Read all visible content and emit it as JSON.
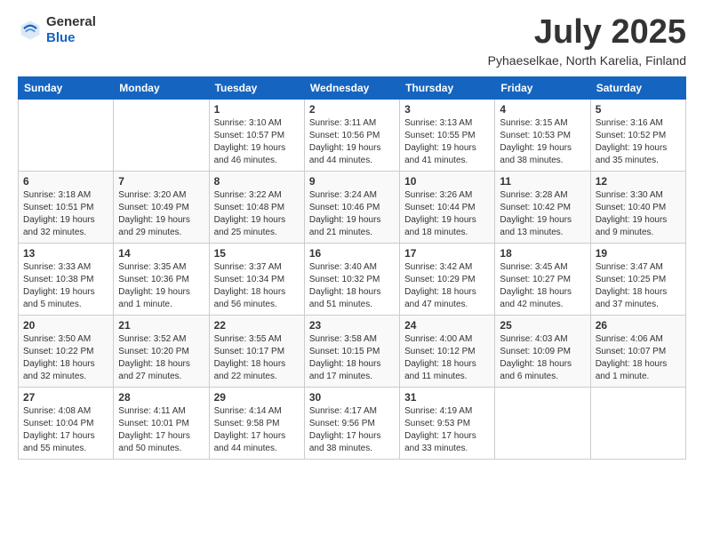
{
  "logo": {
    "general": "General",
    "blue": "Blue"
  },
  "header": {
    "month": "July 2025",
    "location": "Pyhaeselkae, North Karelia, Finland"
  },
  "weekdays": [
    "Sunday",
    "Monday",
    "Tuesday",
    "Wednesday",
    "Thursday",
    "Friday",
    "Saturday"
  ],
  "weeks": [
    [
      {
        "day": "",
        "sunrise": "",
        "sunset": "",
        "daylight": ""
      },
      {
        "day": "",
        "sunrise": "",
        "sunset": "",
        "daylight": ""
      },
      {
        "day": "1",
        "sunrise": "Sunrise: 3:10 AM",
        "sunset": "Sunset: 10:57 PM",
        "daylight": "Daylight: 19 hours and 46 minutes."
      },
      {
        "day": "2",
        "sunrise": "Sunrise: 3:11 AM",
        "sunset": "Sunset: 10:56 PM",
        "daylight": "Daylight: 19 hours and 44 minutes."
      },
      {
        "day": "3",
        "sunrise": "Sunrise: 3:13 AM",
        "sunset": "Sunset: 10:55 PM",
        "daylight": "Daylight: 19 hours and 41 minutes."
      },
      {
        "day": "4",
        "sunrise": "Sunrise: 3:15 AM",
        "sunset": "Sunset: 10:53 PM",
        "daylight": "Daylight: 19 hours and 38 minutes."
      },
      {
        "day": "5",
        "sunrise": "Sunrise: 3:16 AM",
        "sunset": "Sunset: 10:52 PM",
        "daylight": "Daylight: 19 hours and 35 minutes."
      }
    ],
    [
      {
        "day": "6",
        "sunrise": "Sunrise: 3:18 AM",
        "sunset": "Sunset: 10:51 PM",
        "daylight": "Daylight: 19 hours and 32 minutes."
      },
      {
        "day": "7",
        "sunrise": "Sunrise: 3:20 AM",
        "sunset": "Sunset: 10:49 PM",
        "daylight": "Daylight: 19 hours and 29 minutes."
      },
      {
        "day": "8",
        "sunrise": "Sunrise: 3:22 AM",
        "sunset": "Sunset: 10:48 PM",
        "daylight": "Daylight: 19 hours and 25 minutes."
      },
      {
        "day": "9",
        "sunrise": "Sunrise: 3:24 AM",
        "sunset": "Sunset: 10:46 PM",
        "daylight": "Daylight: 19 hours and 21 minutes."
      },
      {
        "day": "10",
        "sunrise": "Sunrise: 3:26 AM",
        "sunset": "Sunset: 10:44 PM",
        "daylight": "Daylight: 19 hours and 18 minutes."
      },
      {
        "day": "11",
        "sunrise": "Sunrise: 3:28 AM",
        "sunset": "Sunset: 10:42 PM",
        "daylight": "Daylight: 19 hours and 13 minutes."
      },
      {
        "day": "12",
        "sunrise": "Sunrise: 3:30 AM",
        "sunset": "Sunset: 10:40 PM",
        "daylight": "Daylight: 19 hours and 9 minutes."
      }
    ],
    [
      {
        "day": "13",
        "sunrise": "Sunrise: 3:33 AM",
        "sunset": "Sunset: 10:38 PM",
        "daylight": "Daylight: 19 hours and 5 minutes."
      },
      {
        "day": "14",
        "sunrise": "Sunrise: 3:35 AM",
        "sunset": "Sunset: 10:36 PM",
        "daylight": "Daylight: 19 hours and 1 minute."
      },
      {
        "day": "15",
        "sunrise": "Sunrise: 3:37 AM",
        "sunset": "Sunset: 10:34 PM",
        "daylight": "Daylight: 18 hours and 56 minutes."
      },
      {
        "day": "16",
        "sunrise": "Sunrise: 3:40 AM",
        "sunset": "Sunset: 10:32 PM",
        "daylight": "Daylight: 18 hours and 51 minutes."
      },
      {
        "day": "17",
        "sunrise": "Sunrise: 3:42 AM",
        "sunset": "Sunset: 10:29 PM",
        "daylight": "Daylight: 18 hours and 47 minutes."
      },
      {
        "day": "18",
        "sunrise": "Sunrise: 3:45 AM",
        "sunset": "Sunset: 10:27 PM",
        "daylight": "Daylight: 18 hours and 42 minutes."
      },
      {
        "day": "19",
        "sunrise": "Sunrise: 3:47 AM",
        "sunset": "Sunset: 10:25 PM",
        "daylight": "Daylight: 18 hours and 37 minutes."
      }
    ],
    [
      {
        "day": "20",
        "sunrise": "Sunrise: 3:50 AM",
        "sunset": "Sunset: 10:22 PM",
        "daylight": "Daylight: 18 hours and 32 minutes."
      },
      {
        "day": "21",
        "sunrise": "Sunrise: 3:52 AM",
        "sunset": "Sunset: 10:20 PM",
        "daylight": "Daylight: 18 hours and 27 minutes."
      },
      {
        "day": "22",
        "sunrise": "Sunrise: 3:55 AM",
        "sunset": "Sunset: 10:17 PM",
        "daylight": "Daylight: 18 hours and 22 minutes."
      },
      {
        "day": "23",
        "sunrise": "Sunrise: 3:58 AM",
        "sunset": "Sunset: 10:15 PM",
        "daylight": "Daylight: 18 hours and 17 minutes."
      },
      {
        "day": "24",
        "sunrise": "Sunrise: 4:00 AM",
        "sunset": "Sunset: 10:12 PM",
        "daylight": "Daylight: 18 hours and 11 minutes."
      },
      {
        "day": "25",
        "sunrise": "Sunrise: 4:03 AM",
        "sunset": "Sunset: 10:09 PM",
        "daylight": "Daylight: 18 hours and 6 minutes."
      },
      {
        "day": "26",
        "sunrise": "Sunrise: 4:06 AM",
        "sunset": "Sunset: 10:07 PM",
        "daylight": "Daylight: 18 hours and 1 minute."
      }
    ],
    [
      {
        "day": "27",
        "sunrise": "Sunrise: 4:08 AM",
        "sunset": "Sunset: 10:04 PM",
        "daylight": "Daylight: 17 hours and 55 minutes."
      },
      {
        "day": "28",
        "sunrise": "Sunrise: 4:11 AM",
        "sunset": "Sunset: 10:01 PM",
        "daylight": "Daylight: 17 hours and 50 minutes."
      },
      {
        "day": "29",
        "sunrise": "Sunrise: 4:14 AM",
        "sunset": "Sunset: 9:58 PM",
        "daylight": "Daylight: 17 hours and 44 minutes."
      },
      {
        "day": "30",
        "sunrise": "Sunrise: 4:17 AM",
        "sunset": "Sunset: 9:56 PM",
        "daylight": "Daylight: 17 hours and 38 minutes."
      },
      {
        "day": "31",
        "sunrise": "Sunrise: 4:19 AM",
        "sunset": "Sunset: 9:53 PM",
        "daylight": "Daylight: 17 hours and 33 minutes."
      },
      {
        "day": "",
        "sunrise": "",
        "sunset": "",
        "daylight": ""
      },
      {
        "day": "",
        "sunrise": "",
        "sunset": "",
        "daylight": ""
      }
    ]
  ]
}
